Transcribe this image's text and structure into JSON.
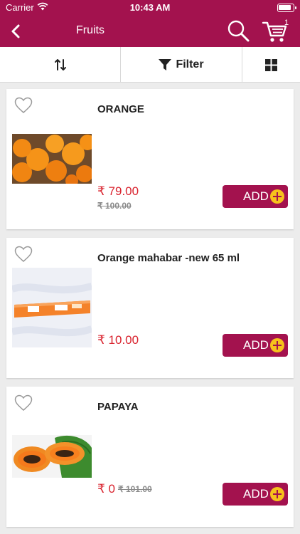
{
  "status_bar": {
    "carrier": "Carrier",
    "time": "10:43 AM"
  },
  "header": {
    "title": "Fruits",
    "cart_count": "1",
    "back_icon": "chevron-left-icon",
    "search_icon": "search-icon",
    "cart_icon": "cart-icon"
  },
  "toolbar": {
    "sort_icon": "sort-arrows-icon",
    "filter_label": "Filter",
    "filter_icon": "funnel-icon",
    "grid_icon": "grid-view-icon"
  },
  "products": [
    {
      "name": "ORANGE",
      "price": "₹ 79.00",
      "mrp": "₹ 100.00",
      "add_label": "ADD"
    },
    {
      "name": "Orange mahabar -new 65 ml",
      "price": "₹ 10.00",
      "mrp": "",
      "add_label": "ADD"
    },
    {
      "name": "PAPAYA",
      "price": "₹ 0",
      "mrp": "₹ 101.00",
      "add_label": "ADD"
    }
  ],
  "colors": {
    "brand": "#a3124e",
    "price": "#d9232e",
    "add_plus": "#f6c21c"
  }
}
